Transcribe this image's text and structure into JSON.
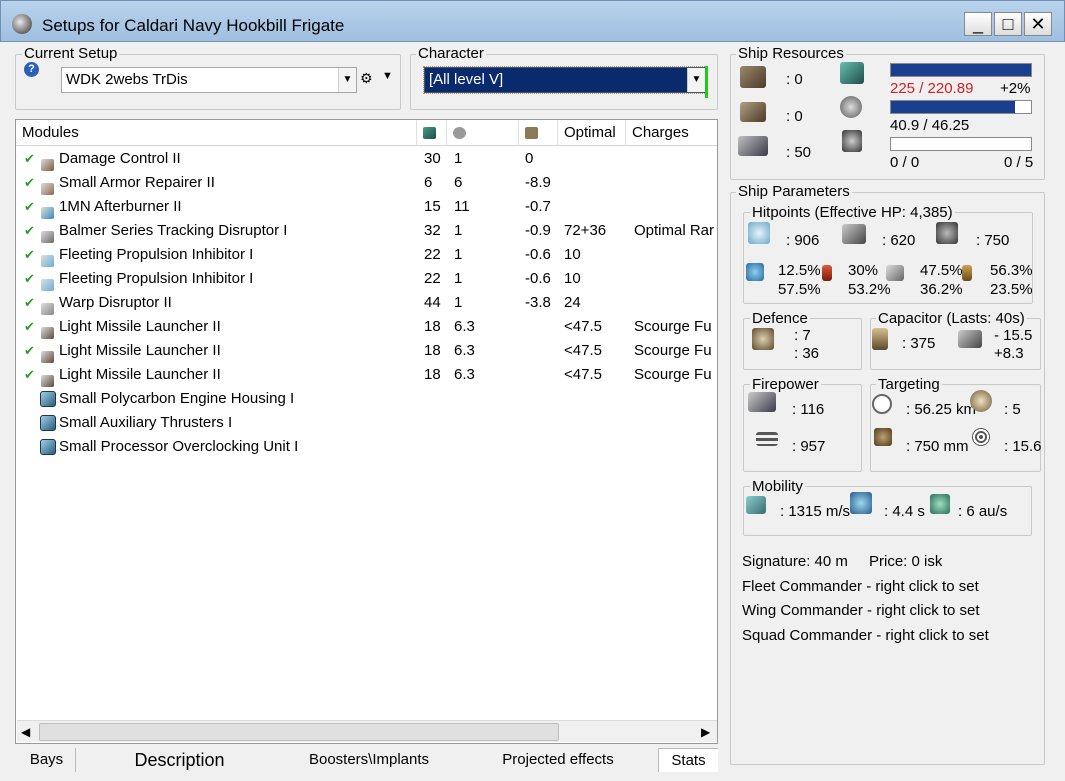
{
  "window": {
    "title": "Setups for Caldari Navy Hookbill Frigate",
    "minimize": "_",
    "maximize": "□",
    "close": "✕"
  },
  "current_setup": {
    "label": "Current Setup",
    "value": "WDK 2webs TrDis",
    "help": "?"
  },
  "character": {
    "label": "Character",
    "value": "[All level V]"
  },
  "modules": {
    "headers": {
      "name": "Modules",
      "optimal": "Optimal",
      "charges": "Charges"
    },
    "rows": [
      {
        "name": "Damage Control II",
        "cpu": "30",
        "pg": "1",
        "cap": "0",
        "optimal": "",
        "charges": "",
        "icon_color": "#7a5a3a"
      },
      {
        "name": "Small Armor Repairer II",
        "cpu": "6",
        "pg": "6",
        "cap": "-8.9",
        "optimal": "",
        "charges": "",
        "icon_color": "#8c6a4c"
      },
      {
        "name": "1MN Afterburner II",
        "cpu": "15",
        "pg": "11",
        "cap": "-0.7",
        "optimal": "",
        "charges": "",
        "icon_color": "#3a88b8"
      },
      {
        "name": "Balmer Series Tracking Disruptor I",
        "cpu": "32",
        "pg": "1",
        "cap": "-0.9",
        "optimal": "72+36",
        "charges": "Optimal Rar",
        "icon_color": "#6a6a6a"
      },
      {
        "name": "Fleeting Propulsion Inhibitor I",
        "cpu": "22",
        "pg": "1",
        "cap": "-0.6",
        "optimal": "10",
        "charges": "",
        "icon_color": "#6ab0d8"
      },
      {
        "name": "Fleeting Propulsion Inhibitor I",
        "cpu": "22",
        "pg": "1",
        "cap": "-0.6",
        "optimal": "10",
        "charges": "",
        "icon_color": "#6ab0d8"
      },
      {
        "name": "Warp Disruptor II",
        "cpu": "44",
        "pg": "1",
        "cap": "-3.8",
        "optimal": "24",
        "charges": "",
        "icon_color": "#888888"
      },
      {
        "name": "Light Missile Launcher II",
        "cpu": "18",
        "pg": "6.3",
        "cap": "",
        "optimal": "<47.5",
        "charges": "Scourge Fu",
        "icon_color": "#5a4a3a"
      },
      {
        "name": "Light Missile Launcher II",
        "cpu": "18",
        "pg": "6.3",
        "cap": "",
        "optimal": "<47.5",
        "charges": "Scourge Fu",
        "icon_color": "#5a4a3a"
      },
      {
        "name": "Light Missile Launcher II",
        "cpu": "18",
        "pg": "6.3",
        "cap": "",
        "optimal": "<47.5",
        "charges": "Scourge Fu",
        "icon_color": "#5a4a3a"
      }
    ],
    "rigs": [
      {
        "name": "Small Polycarbon Engine Housing I"
      },
      {
        "name": "Small Auxiliary Thrusters I"
      },
      {
        "name": "Small Processor Overclocking Unit I"
      }
    ]
  },
  "tabs": [
    "Bays",
    "Description",
    "Boosters\\Implants",
    "Projected effects",
    "Stats"
  ],
  "ship_resources": {
    "label": "Ship Resources",
    "hardpoints": {
      "turret": ": 0",
      "launcher": ": 0",
      "calibration": ": 50"
    },
    "cpu_text": "225 / 220.89",
    "cpu_pct": "+2%",
    "cpu_fraction": 1.0,
    "pg_text": "40.9 / 46.25",
    "pg_fraction": 0.884,
    "drone_bw": "0 / 0",
    "drone_bay": "0 / 5"
  },
  "ship_parameters": {
    "label": "Ship Parameters",
    "hitpoints": {
      "label": "Hitpoints (Effective HP: 4,385)",
      "shield": ": 906",
      "armor": ": 620",
      "structure": ": 750",
      "resists": [
        {
          "top": "12.5%",
          "bottom": "57.5%"
        },
        {
          "top": "30%",
          "bottom": "53.2%"
        },
        {
          "top": "47.5%",
          "bottom": "36.2%"
        },
        {
          "top": "56.3%",
          "bottom": "23.5%"
        }
      ]
    },
    "defence": {
      "label": "Defence",
      "top": ": 7",
      "bottom": ": 36"
    },
    "capacitor": {
      "label": "Capacitor (Lasts: 40s)",
      "amount": ": 375",
      "delta_top": "- 15.5",
      "delta_bottom": "+8.3"
    },
    "firepower": {
      "label": "Firepower",
      "dps": ": 116",
      "volley": ": 957"
    },
    "targeting": {
      "label": "Targeting",
      "range": ": 56.25 km",
      "targets": ": 5",
      "scan": ": 750 mm",
      "sensor": ": 15.6"
    },
    "mobility": {
      "label": "Mobility",
      "speed": ": 1315 m/s",
      "align": ": 4.4 s",
      "warp": ": 6 au/s"
    },
    "signature": "Signature: 40 m",
    "price": "Price: 0 isk",
    "fleet": "Fleet Commander - right click to set",
    "wing": "Wing Commander - right click to set",
    "squad": "Squad Commander - right click to set"
  },
  "colors": {
    "titlebar": "#a9c8e8",
    "selection": "#0a2a6e",
    "overload": "#cc2222",
    "bar": "#1a3f8e"
  }
}
